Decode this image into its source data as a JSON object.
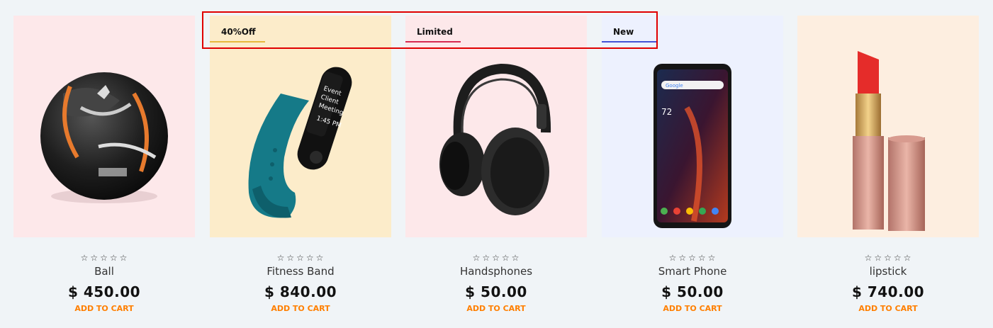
{
  "badges": [
    {
      "label": "40%Off",
      "color": "#e7b93c"
    },
    {
      "label": "Limited",
      "color": "#d62a53"
    },
    {
      "label": "New",
      "color": "#4452d6"
    }
  ],
  "products": [
    {
      "name": "Ball",
      "price": "$ 450.00",
      "cart": "ADD TO CART",
      "bg": "#fde8ea",
      "rating": 0,
      "image": "football-image"
    },
    {
      "name": "Fitness Band",
      "price": "$ 840.00",
      "cart": "ADD TO CART",
      "bg": "#fcecca",
      "rating": 0,
      "image": "fitness-band-image"
    },
    {
      "name": "Handsphones",
      "price": "$ 50.00",
      "cart": "ADD TO CART",
      "bg": "#fde8ea",
      "rating": 0,
      "image": "headphones-image"
    },
    {
      "name": "Smart Phone",
      "price": "$ 50.00",
      "cart": "ADD TO CART",
      "bg": "#edf1fe",
      "rating": 0,
      "image": "smartphone-image"
    },
    {
      "name": "lipstick",
      "price": "$ 740.00",
      "cart": "ADD TO CART",
      "bg": "#fdeee0",
      "rating": 0,
      "image": "lipstick-image"
    }
  ],
  "band_screen": {
    "line1": "Event",
    "line2": "Client",
    "line3": "Meeting",
    "time": "1:45 PM"
  },
  "phone_screen": {
    "search": "Google",
    "temp": "72"
  },
  "colors": {
    "accent": "#ff7f00",
    "highlight": "#e00000"
  }
}
